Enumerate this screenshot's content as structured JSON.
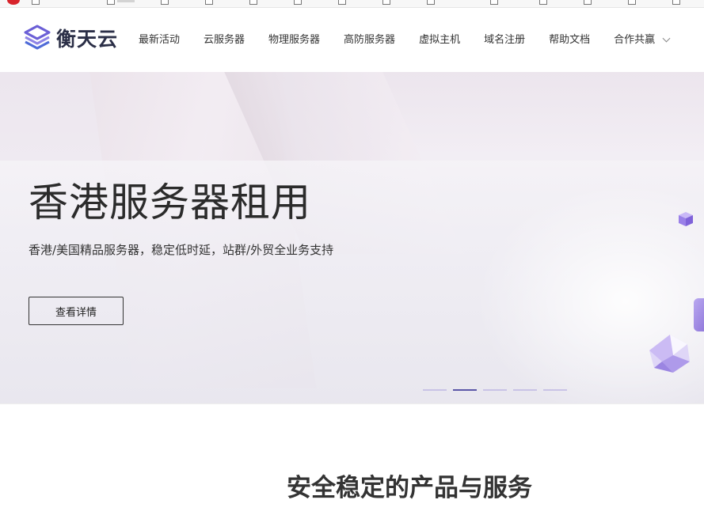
{
  "brand": {
    "name": "衡天云"
  },
  "nav": {
    "items": [
      {
        "label": "最新活动"
      },
      {
        "label": "云服务器"
      },
      {
        "label": "物理服务器"
      },
      {
        "label": "高防服务器"
      },
      {
        "label": "虚拟主机"
      },
      {
        "label": "域名注册"
      },
      {
        "label": "帮助文档"
      },
      {
        "label": "合作共赢"
      }
    ]
  },
  "hero": {
    "title": "香港服务器租用",
    "subtitle": "香港/美国精品服务器，稳定低时延，站群/外贸全业务支持",
    "button": "查看详情",
    "slide_count": 5,
    "active_slide": 2
  },
  "section": {
    "title": "安全稳定的产品与服务"
  },
  "colors": {
    "logo_accent": "#6b5fd6",
    "text_dark": "#2b2b2b",
    "dot_active": "#5b56a8",
    "dot_inactive": "#c9c3e6"
  }
}
